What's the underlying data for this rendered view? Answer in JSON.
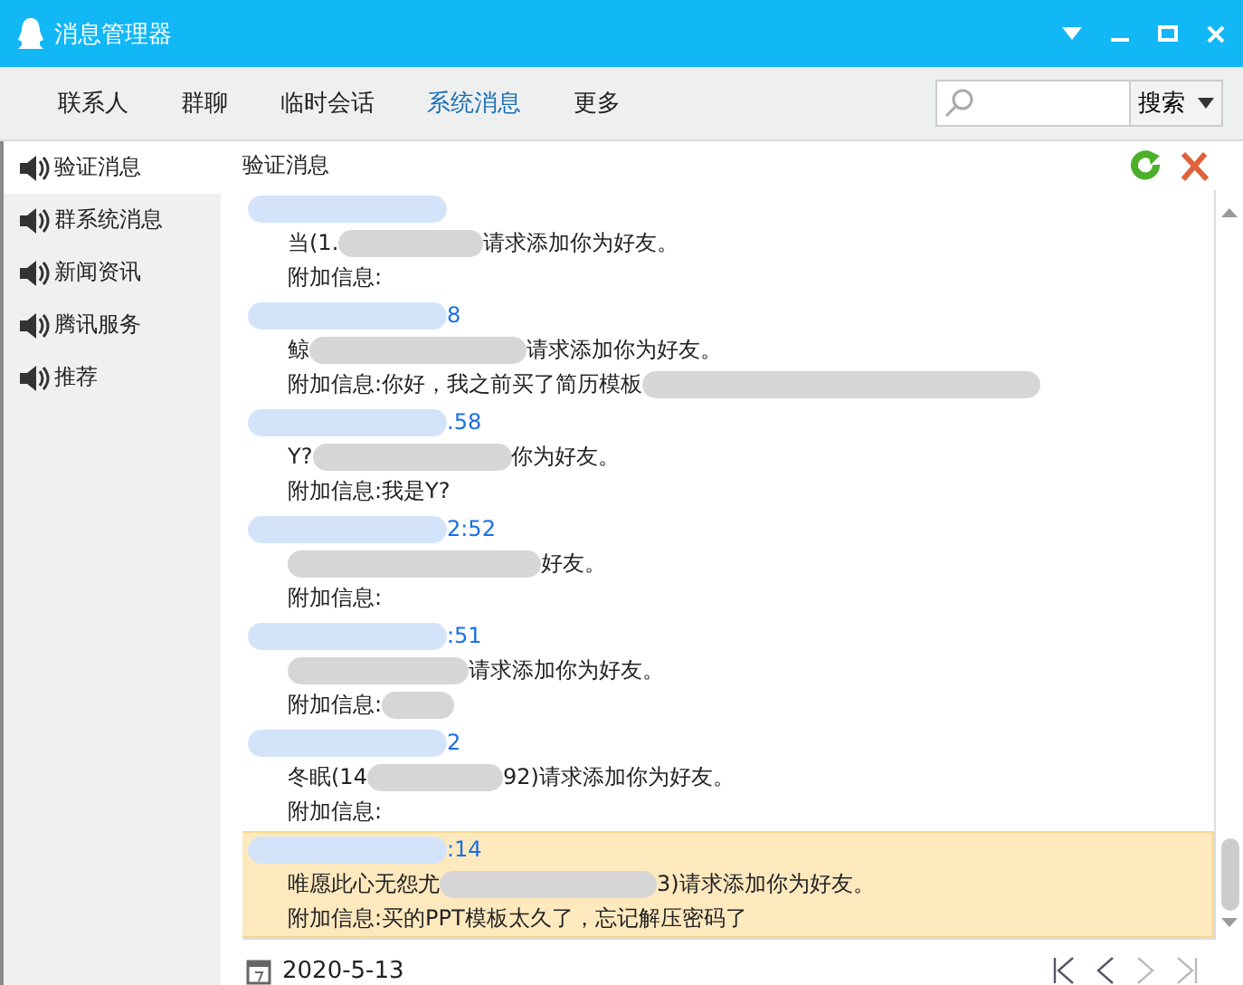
{
  "window": {
    "title": "消息管理器"
  },
  "tabs": [
    {
      "label": "联系人",
      "selected": false
    },
    {
      "label": "群聊",
      "selected": false
    },
    {
      "label": "临时会话",
      "selected": false
    },
    {
      "label": "系统消息",
      "selected": true
    },
    {
      "label": "更多",
      "selected": false
    }
  ],
  "search": {
    "button": "搜索"
  },
  "sidebar": {
    "items": [
      {
        "label": "验证消息",
        "selected": true
      },
      {
        "label": "群系统消息",
        "selected": false
      },
      {
        "label": "新闻资讯",
        "selected": false
      },
      {
        "label": "腾讯服务",
        "selected": false
      },
      {
        "label": "推荐",
        "selected": false
      }
    ]
  },
  "panel": {
    "title": "验证消息"
  },
  "messages": [
    {
      "sender": "当(1.",
      "request": "请求添加你为好友。",
      "note": "附加信息:",
      "note_blurred": false,
      "selected": false
    },
    {
      "time": "8",
      "sender": "鲸",
      "request": "请求添加你为好友。",
      "note": "附加信息:你好，我之前买了简历模板",
      "note_blurred": true,
      "selected": false
    },
    {
      "time": ".58",
      "sender": "Y?",
      "request": "你为好友。",
      "note": "附加信息:我是Y?",
      "note_blurred": false,
      "selected": false
    },
    {
      "time": "2:52",
      "request": "好友。",
      "note": "附加信息:",
      "note_blurred": false,
      "selected": false
    },
    {
      "time": ":51",
      "request": "请求添加你为好友。",
      "note": "附加信息:",
      "note_blurred": true,
      "selected": false
    },
    {
      "time": "2",
      "sender": "冬眠(14",
      "request": "92)请求添加你为好友。",
      "note": "附加信息:",
      "note_blurred": false,
      "selected": false
    },
    {
      "time": ":14",
      "sender": "唯愿此心无怨尤",
      "request": "3)请求添加你为好友。",
      "note": "附加信息:买的PPT模板太久了，忘记解压密码了",
      "note_blurred": false,
      "selected": true
    }
  ],
  "footer": {
    "date": "2020-5-13"
  }
}
